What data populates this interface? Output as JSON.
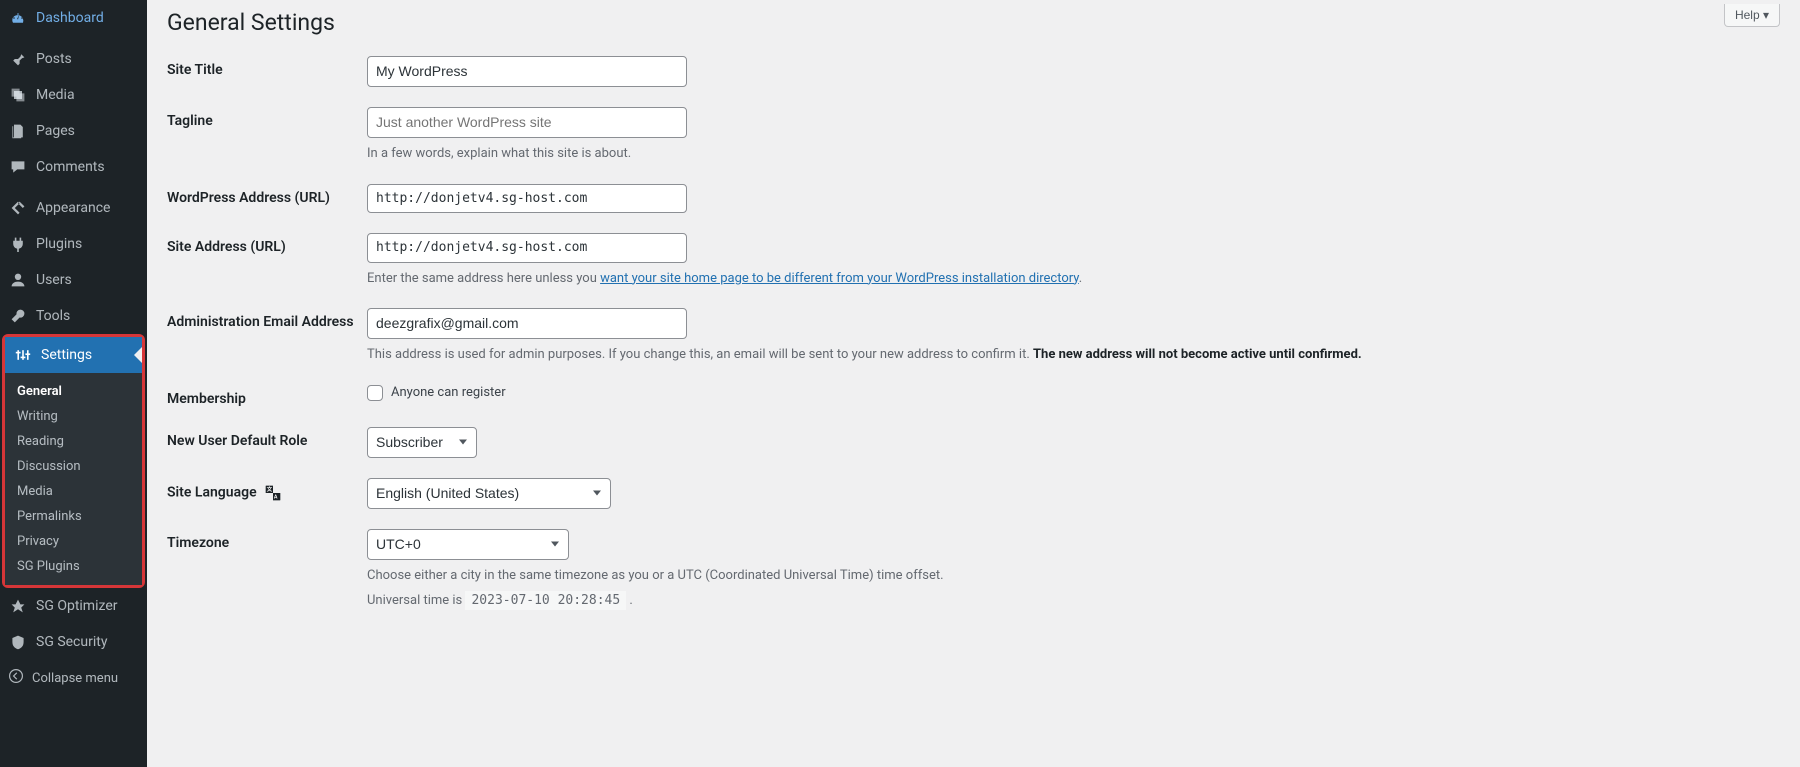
{
  "help_label": "Help ▾",
  "page_title": "General Settings",
  "sidebar": {
    "items": [
      {
        "label": "Dashboard",
        "icon": "dashboard"
      },
      {
        "label": "Posts",
        "icon": "pin"
      },
      {
        "label": "Media",
        "icon": "media"
      },
      {
        "label": "Pages",
        "icon": "pages"
      },
      {
        "label": "Comments",
        "icon": "comments"
      },
      {
        "label": "Appearance",
        "icon": "appearance"
      },
      {
        "label": "Plugins",
        "icon": "plugin"
      },
      {
        "label": "Users",
        "icon": "user"
      },
      {
        "label": "Tools",
        "icon": "tools"
      },
      {
        "label": "Settings",
        "icon": "settings",
        "active": true
      },
      {
        "label": "SG Optimizer",
        "icon": "sg"
      },
      {
        "label": "SG Security",
        "icon": "sg-sec"
      }
    ],
    "submenu": [
      {
        "label": "General",
        "current": true
      },
      {
        "label": "Writing"
      },
      {
        "label": "Reading"
      },
      {
        "label": "Discussion"
      },
      {
        "label": "Media"
      },
      {
        "label": "Permalinks"
      },
      {
        "label": "Privacy"
      },
      {
        "label": "SG Plugins"
      }
    ],
    "collapse_label": "Collapse menu"
  },
  "form": {
    "site_title": {
      "label": "Site Title",
      "value": "My WordPress"
    },
    "tagline": {
      "label": "Tagline",
      "placeholder": "Just another WordPress site",
      "desc": "In a few words, explain what this site is about."
    },
    "wp_url": {
      "label": "WordPress Address (URL)",
      "value": "http://donjetv4.sg-host.com"
    },
    "site_url": {
      "label": "Site Address (URL)",
      "value": "http://donjetv4.sg-host.com",
      "desc_pre": "Enter the same address here unless you ",
      "desc_link": "want your site home page to be different from your WordPress installation directory",
      "desc_post": "."
    },
    "admin_email": {
      "label": "Administration Email Address",
      "value": "deezgrafix@gmail.com",
      "desc_pre": "This address is used for admin purposes. If you change this, an email will be sent to your new address to confirm it. ",
      "desc_strong": "The new address will not become active until confirmed."
    },
    "membership": {
      "label": "Membership",
      "checkbox_label": "Anyone can register"
    },
    "default_role": {
      "label": "New User Default Role",
      "value": "Subscriber"
    },
    "language": {
      "label": "Site Language",
      "value": "English (United States)"
    },
    "timezone": {
      "label": "Timezone",
      "value": "UTC+0",
      "desc": "Choose either a city in the same timezone as you or a UTC (Coordinated Universal Time) time offset.",
      "universal_pre": "Universal time is ",
      "universal_time": "2023-07-10 20:28:45",
      "universal_post": " ."
    }
  }
}
